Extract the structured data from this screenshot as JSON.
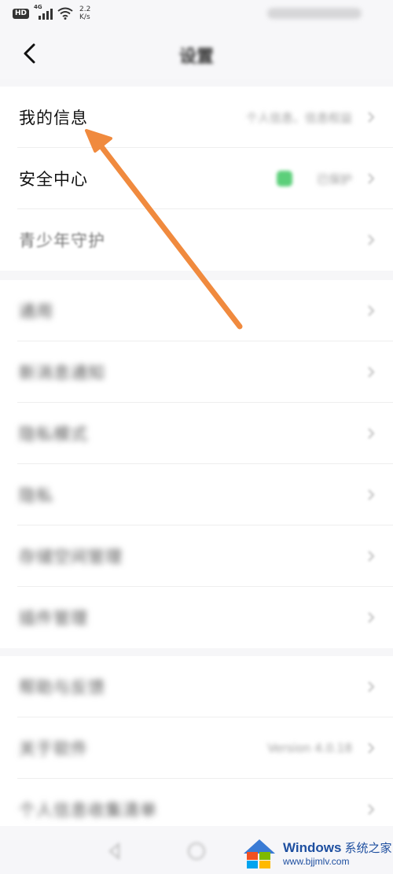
{
  "status_bar": {
    "hd_badge": "HD",
    "signal_label": "4G",
    "speed_value": "2.2",
    "speed_unit": "K/s"
  },
  "header": {
    "title": "设置",
    "back_icon": "chevron-left-icon"
  },
  "groups": [
    {
      "rows": [
        {
          "label": "我的信息",
          "value": "个人信息、信息权益"
        },
        {
          "label": "安全中心",
          "value": "已保护",
          "status_color": "#5ccf7a"
        },
        {
          "label": "青少年守护",
          "value": ""
        }
      ]
    },
    {
      "rows": [
        {
          "label": "通用"
        },
        {
          "label": "新消息通知"
        },
        {
          "label": "隐私模式"
        },
        {
          "label": "隐私"
        },
        {
          "label": "存储空间管理"
        },
        {
          "label": "插件管理"
        }
      ]
    },
    {
      "rows": [
        {
          "label": "帮助与反馈"
        },
        {
          "label": "关于软件",
          "value": "Version 4.0.18"
        },
        {
          "label": "个人信息收集清单"
        }
      ]
    }
  ],
  "annotation": {
    "color": "#f08a3e"
  },
  "watermark": {
    "brand": "Windows",
    "brand_cn": "系统之家",
    "url": "www.bjjmlv.com"
  }
}
